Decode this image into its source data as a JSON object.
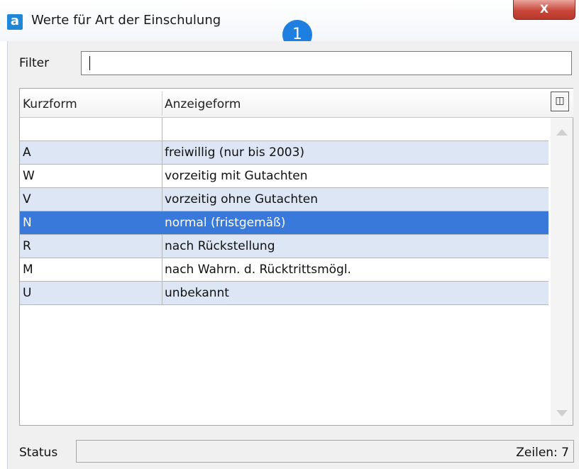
{
  "window": {
    "title": "Werte für Art der Einschulung",
    "app_icon": "a",
    "step_badge": "1",
    "close_label": "X"
  },
  "filter": {
    "label": "Filter",
    "value": ""
  },
  "grid": {
    "columns": [
      "Kurzform",
      "Anzeigeform"
    ],
    "column_chooser_icon": "column-chooser-icon",
    "rows": [
      {
        "kurzform": "A",
        "anzeigeform": "freiwillig (nur bis 2003)"
      },
      {
        "kurzform": "W",
        "anzeigeform": "vorzeitig mit Gutachten"
      },
      {
        "kurzform": "V",
        "anzeigeform": "vorzeitig ohne Gutachten"
      },
      {
        "kurzform": "N",
        "anzeigeform": "normal (fristgemäß)",
        "selected": true
      },
      {
        "kurzform": "R",
        "anzeigeform": "nach Rückstellung"
      },
      {
        "kurzform": "M",
        "anzeigeform": "nach Wahrn. d. Rücktrittsmögl."
      },
      {
        "kurzform": "U",
        "anzeigeform": "unbekannt"
      }
    ]
  },
  "status": {
    "label": "Status",
    "count": "Zeilen: 7"
  },
  "colors": {
    "row_alt": "#dce6f4",
    "row_selected": "#3879d9",
    "badge": "#1d7fe0",
    "close_button": "#c9473a"
  }
}
